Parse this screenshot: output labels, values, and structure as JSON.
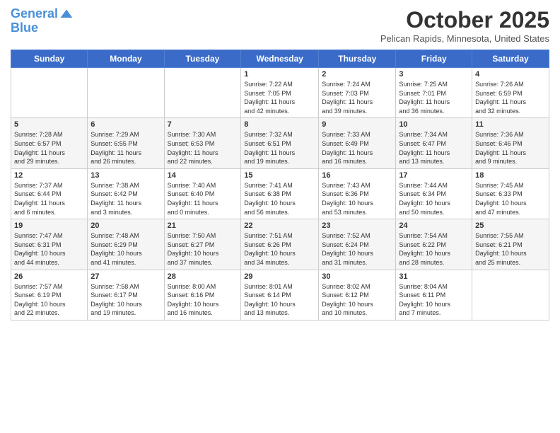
{
  "header": {
    "logo_line1": "General",
    "logo_line2": "Blue",
    "month_title": "October 2025",
    "location": "Pelican Rapids, Minnesota, United States"
  },
  "days_of_week": [
    "Sunday",
    "Monday",
    "Tuesday",
    "Wednesday",
    "Thursday",
    "Friday",
    "Saturday"
  ],
  "weeks": [
    [
      {
        "day": "",
        "info": ""
      },
      {
        "day": "",
        "info": ""
      },
      {
        "day": "",
        "info": ""
      },
      {
        "day": "1",
        "info": "Sunrise: 7:22 AM\nSunset: 7:05 PM\nDaylight: 11 hours\nand 42 minutes."
      },
      {
        "day": "2",
        "info": "Sunrise: 7:24 AM\nSunset: 7:03 PM\nDaylight: 11 hours\nand 39 minutes."
      },
      {
        "day": "3",
        "info": "Sunrise: 7:25 AM\nSunset: 7:01 PM\nDaylight: 11 hours\nand 36 minutes."
      },
      {
        "day": "4",
        "info": "Sunrise: 7:26 AM\nSunset: 6:59 PM\nDaylight: 11 hours\nand 32 minutes."
      }
    ],
    [
      {
        "day": "5",
        "info": "Sunrise: 7:28 AM\nSunset: 6:57 PM\nDaylight: 11 hours\nand 29 minutes."
      },
      {
        "day": "6",
        "info": "Sunrise: 7:29 AM\nSunset: 6:55 PM\nDaylight: 11 hours\nand 26 minutes."
      },
      {
        "day": "7",
        "info": "Sunrise: 7:30 AM\nSunset: 6:53 PM\nDaylight: 11 hours\nand 22 minutes."
      },
      {
        "day": "8",
        "info": "Sunrise: 7:32 AM\nSunset: 6:51 PM\nDaylight: 11 hours\nand 19 minutes."
      },
      {
        "day": "9",
        "info": "Sunrise: 7:33 AM\nSunset: 6:49 PM\nDaylight: 11 hours\nand 16 minutes."
      },
      {
        "day": "10",
        "info": "Sunrise: 7:34 AM\nSunset: 6:47 PM\nDaylight: 11 hours\nand 13 minutes."
      },
      {
        "day": "11",
        "info": "Sunrise: 7:36 AM\nSunset: 6:46 PM\nDaylight: 11 hours\nand 9 minutes."
      }
    ],
    [
      {
        "day": "12",
        "info": "Sunrise: 7:37 AM\nSunset: 6:44 PM\nDaylight: 11 hours\nand 6 minutes."
      },
      {
        "day": "13",
        "info": "Sunrise: 7:38 AM\nSunset: 6:42 PM\nDaylight: 11 hours\nand 3 minutes."
      },
      {
        "day": "14",
        "info": "Sunrise: 7:40 AM\nSunset: 6:40 PM\nDaylight: 11 hours\nand 0 minutes."
      },
      {
        "day": "15",
        "info": "Sunrise: 7:41 AM\nSunset: 6:38 PM\nDaylight: 10 hours\nand 56 minutes."
      },
      {
        "day": "16",
        "info": "Sunrise: 7:43 AM\nSunset: 6:36 PM\nDaylight: 10 hours\nand 53 minutes."
      },
      {
        "day": "17",
        "info": "Sunrise: 7:44 AM\nSunset: 6:34 PM\nDaylight: 10 hours\nand 50 minutes."
      },
      {
        "day": "18",
        "info": "Sunrise: 7:45 AM\nSunset: 6:33 PM\nDaylight: 10 hours\nand 47 minutes."
      }
    ],
    [
      {
        "day": "19",
        "info": "Sunrise: 7:47 AM\nSunset: 6:31 PM\nDaylight: 10 hours\nand 44 minutes."
      },
      {
        "day": "20",
        "info": "Sunrise: 7:48 AM\nSunset: 6:29 PM\nDaylight: 10 hours\nand 41 minutes."
      },
      {
        "day": "21",
        "info": "Sunrise: 7:50 AM\nSunset: 6:27 PM\nDaylight: 10 hours\nand 37 minutes."
      },
      {
        "day": "22",
        "info": "Sunrise: 7:51 AM\nSunset: 6:26 PM\nDaylight: 10 hours\nand 34 minutes."
      },
      {
        "day": "23",
        "info": "Sunrise: 7:52 AM\nSunset: 6:24 PM\nDaylight: 10 hours\nand 31 minutes."
      },
      {
        "day": "24",
        "info": "Sunrise: 7:54 AM\nSunset: 6:22 PM\nDaylight: 10 hours\nand 28 minutes."
      },
      {
        "day": "25",
        "info": "Sunrise: 7:55 AM\nSunset: 6:21 PM\nDaylight: 10 hours\nand 25 minutes."
      }
    ],
    [
      {
        "day": "26",
        "info": "Sunrise: 7:57 AM\nSunset: 6:19 PM\nDaylight: 10 hours\nand 22 minutes."
      },
      {
        "day": "27",
        "info": "Sunrise: 7:58 AM\nSunset: 6:17 PM\nDaylight: 10 hours\nand 19 minutes."
      },
      {
        "day": "28",
        "info": "Sunrise: 8:00 AM\nSunset: 6:16 PM\nDaylight: 10 hours\nand 16 minutes."
      },
      {
        "day": "29",
        "info": "Sunrise: 8:01 AM\nSunset: 6:14 PM\nDaylight: 10 hours\nand 13 minutes."
      },
      {
        "day": "30",
        "info": "Sunrise: 8:02 AM\nSunset: 6:12 PM\nDaylight: 10 hours\nand 10 minutes."
      },
      {
        "day": "31",
        "info": "Sunrise: 8:04 AM\nSunset: 6:11 PM\nDaylight: 10 hours\nand 7 minutes."
      },
      {
        "day": "",
        "info": ""
      }
    ]
  ]
}
